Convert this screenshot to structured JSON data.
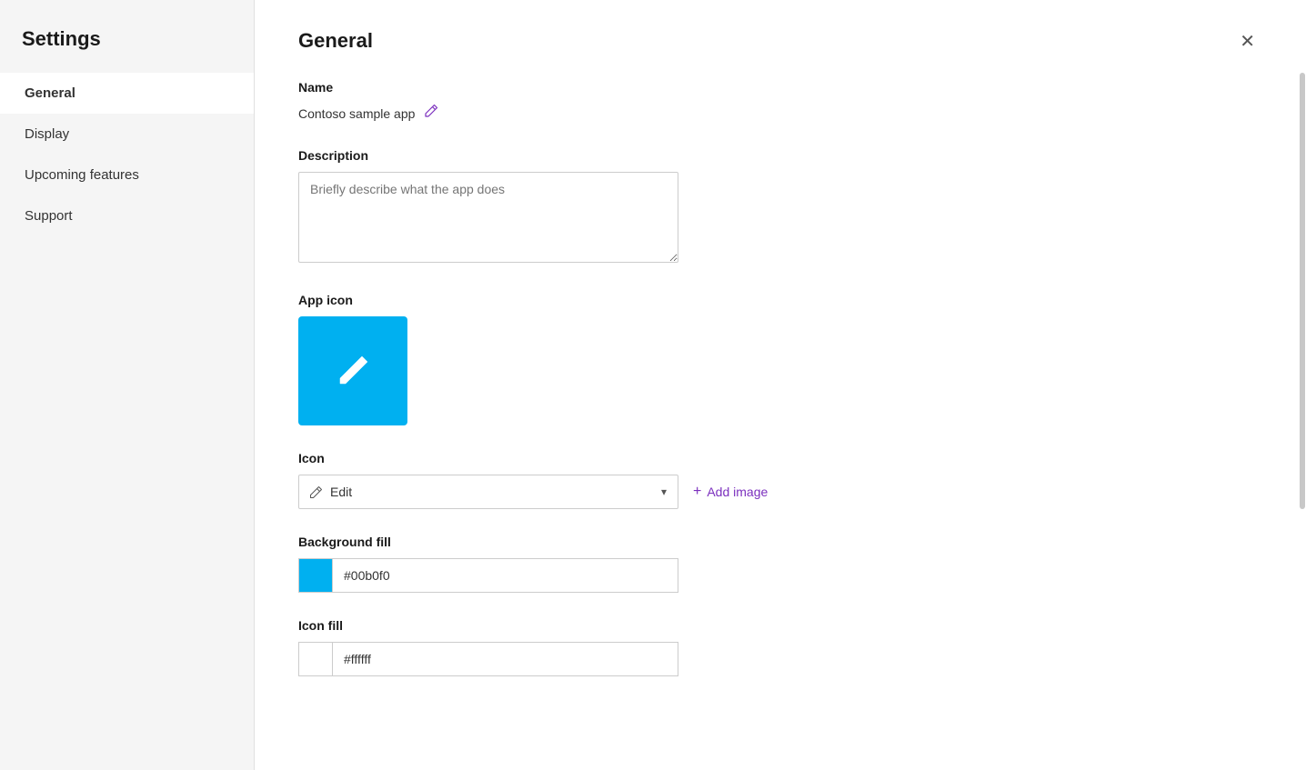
{
  "sidebar": {
    "title": "Settings",
    "nav_items": [
      {
        "id": "general",
        "label": "General",
        "active": true
      },
      {
        "id": "display",
        "label": "Display",
        "active": false
      },
      {
        "id": "upcoming-features",
        "label": "Upcoming features",
        "active": false
      },
      {
        "id": "support",
        "label": "Support",
        "active": false
      }
    ]
  },
  "main": {
    "title": "General",
    "close_button_label": "✕",
    "sections": {
      "name": {
        "label": "Name",
        "value": "Contoso sample app",
        "edit_icon": "✏"
      },
      "description": {
        "label": "Description",
        "placeholder": "Briefly describe what the app does"
      },
      "app_icon": {
        "label": "App icon",
        "icon_color": "#00b0f0"
      },
      "icon": {
        "label": "Icon",
        "selected_value": "Edit",
        "add_image_label": "+ Add image"
      },
      "background_fill": {
        "label": "Background fill",
        "color": "#00b0f0",
        "hex_value": "#00b0f0"
      },
      "icon_fill": {
        "label": "Icon fill",
        "color": "#ffffff",
        "hex_value": "#ffffff"
      }
    }
  }
}
